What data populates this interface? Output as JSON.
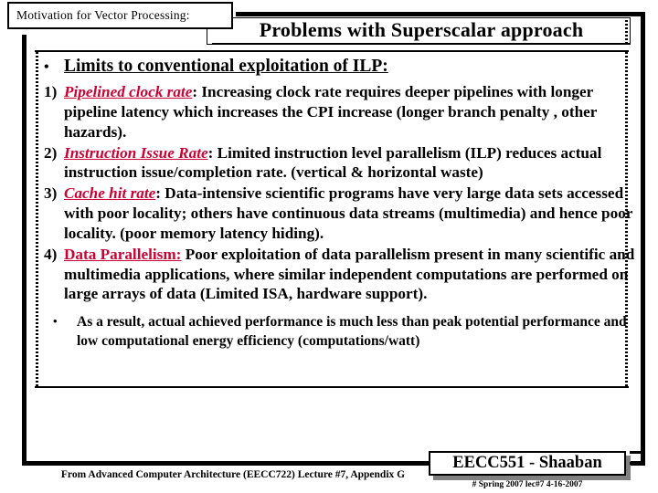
{
  "caption": {
    "text": "Motivation for Vector Processing:"
  },
  "title": {
    "text": "Problems with Superscalar approach"
  },
  "main_bullet": {
    "marker": "•",
    "label": "Limits to conventional exploitation of ILP:"
  },
  "items": [
    {
      "num": "1)",
      "term": "Pipelined clock rate",
      "term_style": "bold-italic-underline-red",
      "body": ":  Increasing clock rate requires deeper pipelines  with longer pipeline latency which increases the CPI increase (longer branch penalty , other hazards)."
    },
    {
      "num": "2)",
      "term": "Instruction Issue Rate",
      "term_style": "bold-italic-underline-red",
      "body": ":  Limited instruction level parallelism (ILP) reduces actual instruction issue/completion rate. (vertical & horizontal waste)"
    },
    {
      "num": "3)",
      "term": "Cache hit rate",
      "term_style": "bold-italic-underline-red",
      "body": ":  Data-intensive scientific programs have very large data sets accessed with poor locality;  others have continuous data streams (multimedia) and hence poor locality.  (poor memory latency hiding)."
    },
    {
      "num": "4)",
      "term": "Data Parallelism:",
      "term_style": "bold-underline-red",
      "body": "  Poor exploitation of data parallelism present in many scientific and multimedia applications, where similar independent computations are performed on large arrays of data (Limited ISA, hardware support)."
    }
  ],
  "closing_bullet": {
    "marker": "•",
    "text": "As a result, actual achieved performance is much less than peak potential performance and low computational energy efficiency (computations/watt)"
  },
  "source": {
    "text": "From Advanced Computer Architecture (EECC722) Lecture #7, Appendix G"
  },
  "signature": {
    "title": "EECC551 - Shaaban",
    "subtitle": "#  Spring 2007  lec#7   4-16-2007"
  },
  "colors": {
    "accent_red": "#CC0033",
    "ink": "#000000",
    "shadow": "#808080",
    "page": "#FFFFFF"
  }
}
